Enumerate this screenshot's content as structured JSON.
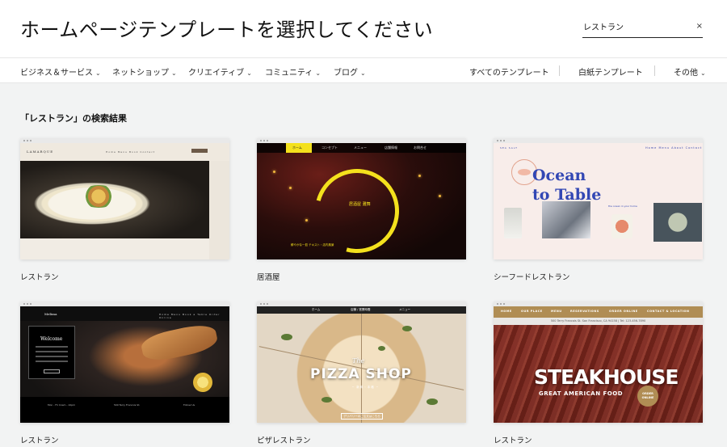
{
  "header": {
    "title": "ホームページテンプレートを選択してください",
    "search_value": "レストラン",
    "search_clear": "×"
  },
  "nav": {
    "categories": [
      {
        "label": "ビジネス＆サービス"
      },
      {
        "label": "ネットショップ"
      },
      {
        "label": "クリエイティブ"
      },
      {
        "label": "コミュニティ"
      },
      {
        "label": "ブログ"
      }
    ],
    "all_templates": "すべてのテンプレート",
    "blank_templates": "白紙テンプレート",
    "other": "その他"
  },
  "results": {
    "title": "「レストラン」の検索結果",
    "cards": [
      {
        "label": "レストラン",
        "thumb": {
          "logo": "LAMARQUE",
          "links": "Home  Menu  Book  Contact"
        }
      },
      {
        "label": "居酒屋",
        "thumb": {
          "menu": [
            "ホーム",
            "コンセプト",
            "メニュー",
            "店舗情報",
            "お問合せ"
          ],
          "kanji": "居酒屋 灘舞",
          "footer": "鮮やかな一皿 テキスト・店内風景"
        }
      },
      {
        "label": "シーフードレストラン",
        "thumb": {
          "brand": "SEA SALT",
          "links": "Home  Menu  About  Contact",
          "headline_1": "Ocean",
          "headline_2": "to Table",
          "tagline": "the ocean in your home"
        }
      },
      {
        "label": "レストラン",
        "thumb": {
          "logo": "Melissa",
          "links": "Home  Menu  Book a Table  Order Online",
          "welcome": "Welcome",
          "footer_left": "Mon - Fri  11am - 10pm",
          "footer_mid": "500 Terry Francois St.",
          "footer_right": "Follow Us"
        }
      },
      {
        "label": "ピザレストラン",
        "thumb": {
          "menu": [
            "ホーム",
            "店舗 / 営業時間",
            "メニュー"
          ],
          "the": "The",
          "name": "PIZZA SHOP",
          "sub": "─ 新鮮・本格 ─",
          "button": "デリバリーのご注文はこちら"
        }
      },
      {
        "label": "レストラン",
        "thumb": {
          "menu": [
            "HOME",
            "OUR PLACE",
            "MENU",
            "RESERVATIONS",
            "ORDER ONLINE",
            "CONTACT & LOCATION"
          ],
          "address": "500 Terry Francois St. San Francisco, CA 94158 | Tel: 123-456-7890",
          "name": "STEAKHOUSE",
          "sub": "GREAT AMERICAN FOOD",
          "badge": "ORDER ONLINE"
        }
      }
    ]
  },
  "colors": {
    "background": "#f2f3f3",
    "izakaya_accent": "#f4e11d",
    "ocean_blue": "#3247b4",
    "steak_gold": "#b08d54"
  },
  "icons": {
    "chevron": "chevron-down-icon",
    "clear": "close-icon"
  }
}
